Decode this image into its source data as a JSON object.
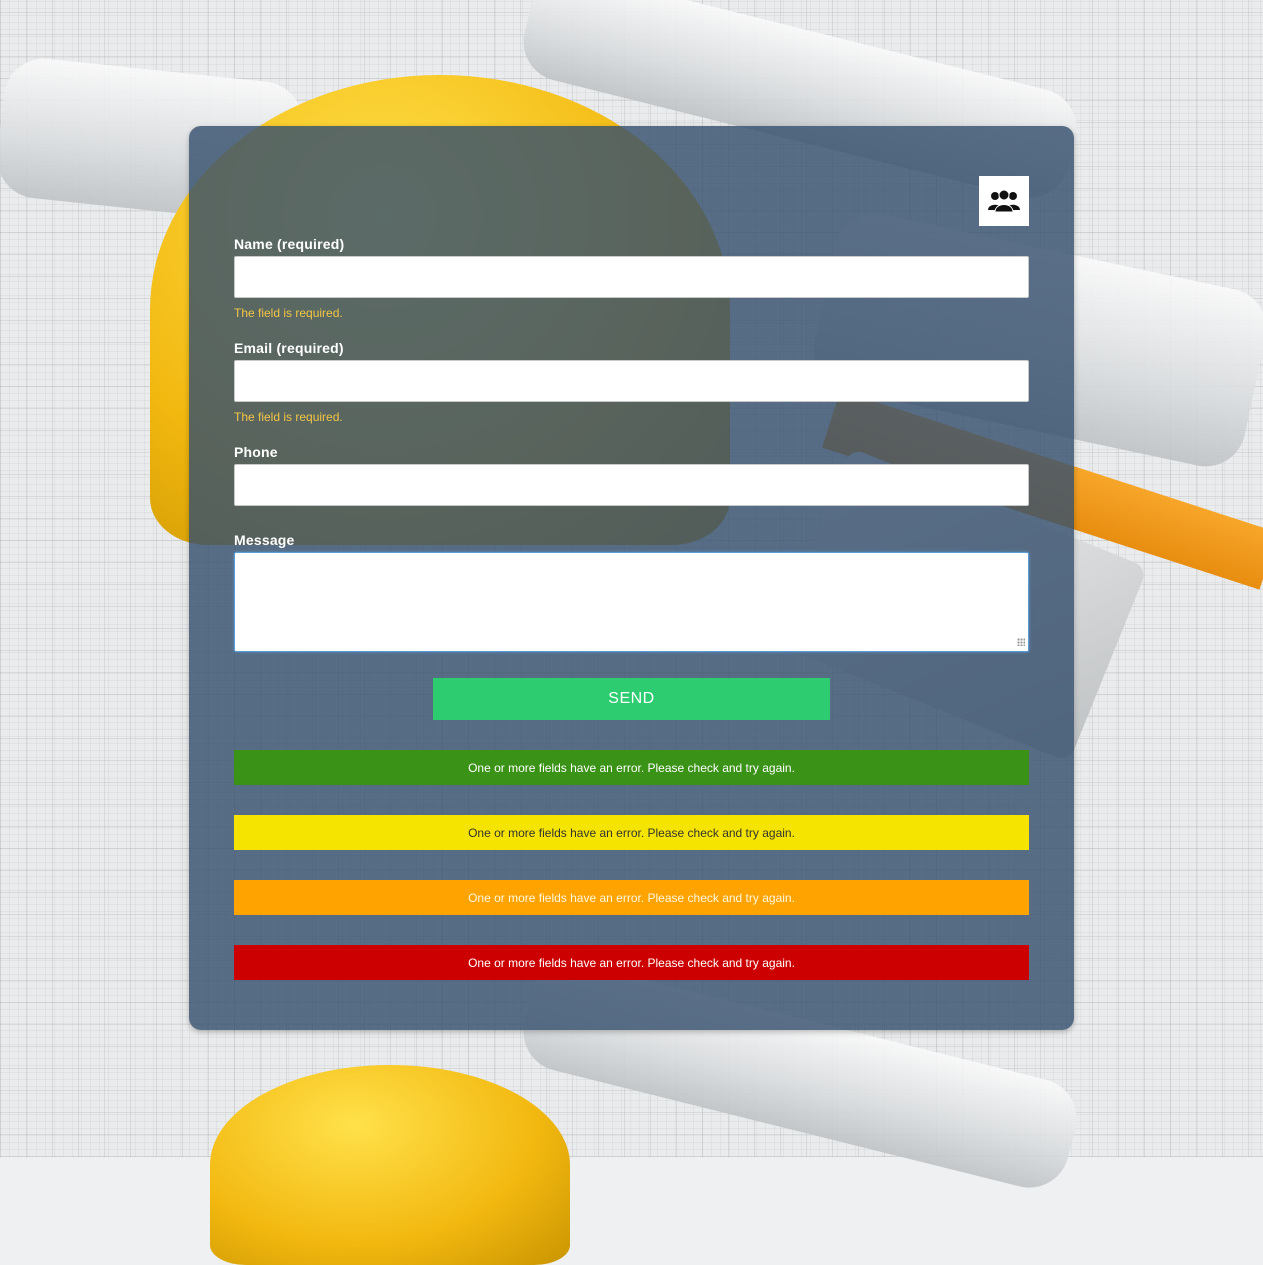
{
  "form": {
    "fields": [
      {
        "label": "Name (required)",
        "value": "",
        "error": "The field is required."
      },
      {
        "label": "Email (required)",
        "value": "",
        "error": "The field is required."
      },
      {
        "label": "Phone",
        "value": ""
      },
      {
        "label": "Message",
        "value": ""
      }
    ],
    "submit_label": "SEND",
    "team_icon": "team-icon"
  },
  "notices": [
    {
      "text": "One or more fields have an error. Please check and try again.",
      "color": "#3a9217"
    },
    {
      "text": "One or more fields have an error. Please check and try again.",
      "color": "#f5e400"
    },
    {
      "text": "One or more fields have an error. Please check and try again.",
      "color": "#ffa300"
    },
    {
      "text": "One or more fields have an error. Please check and try again.",
      "color": "#cc0000"
    }
  ],
  "colors": {
    "card": "#37506e",
    "submit": "#2ecc71",
    "error_text": "#f3c646"
  }
}
